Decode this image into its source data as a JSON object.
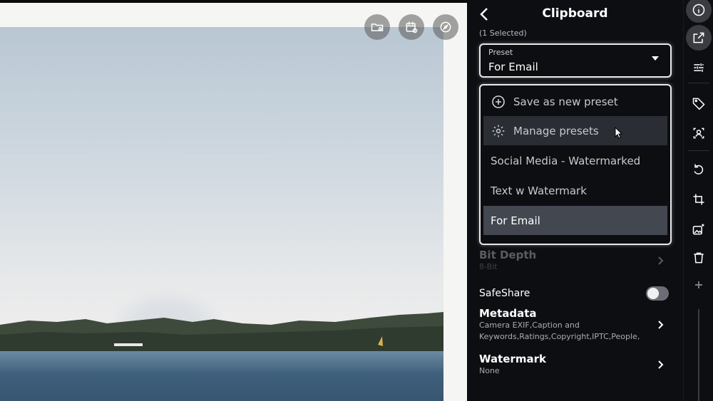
{
  "panel": {
    "title": "Clipboard",
    "selected_count": "(1 Selected)",
    "preset": {
      "label": "Preset",
      "value": "For Email"
    },
    "dropdown": {
      "save_new": "Save as new preset",
      "manage": "Manage presets",
      "options": [
        "Social Media - Watermarked",
        "Text w Watermark",
        "For Email"
      ],
      "selected": "For Email"
    },
    "bit_depth": {
      "title": "Bit Depth",
      "sub": "8-Bit"
    },
    "safeshare": {
      "label": "SafeShare",
      "enabled": false
    },
    "metadata": {
      "title": "Metadata",
      "sub_line1": "Camera EXIF,Caption and",
      "sub_line2": "Keywords,Ratings,Copyright,IPTC,People,"
    },
    "watermark": {
      "title": "Watermark",
      "sub": "None"
    }
  },
  "photo_overlay_icons": [
    "folder-location-icon",
    "calendar-eye-icon",
    "compass-icon"
  ],
  "rail_icons": [
    "info-icon",
    "share-export-icon",
    "adjust-sliders-icon",
    "tag-icon",
    "person-tag-icon",
    "rotate-icon",
    "crop-icon",
    "image-edit-icon",
    "trash-icon",
    "add-icon"
  ],
  "colors": {
    "panel_bg": "#0d0e11",
    "selected_item": "#434750",
    "hover_item": "#2a2d34",
    "border": "#e9e9e9"
  }
}
